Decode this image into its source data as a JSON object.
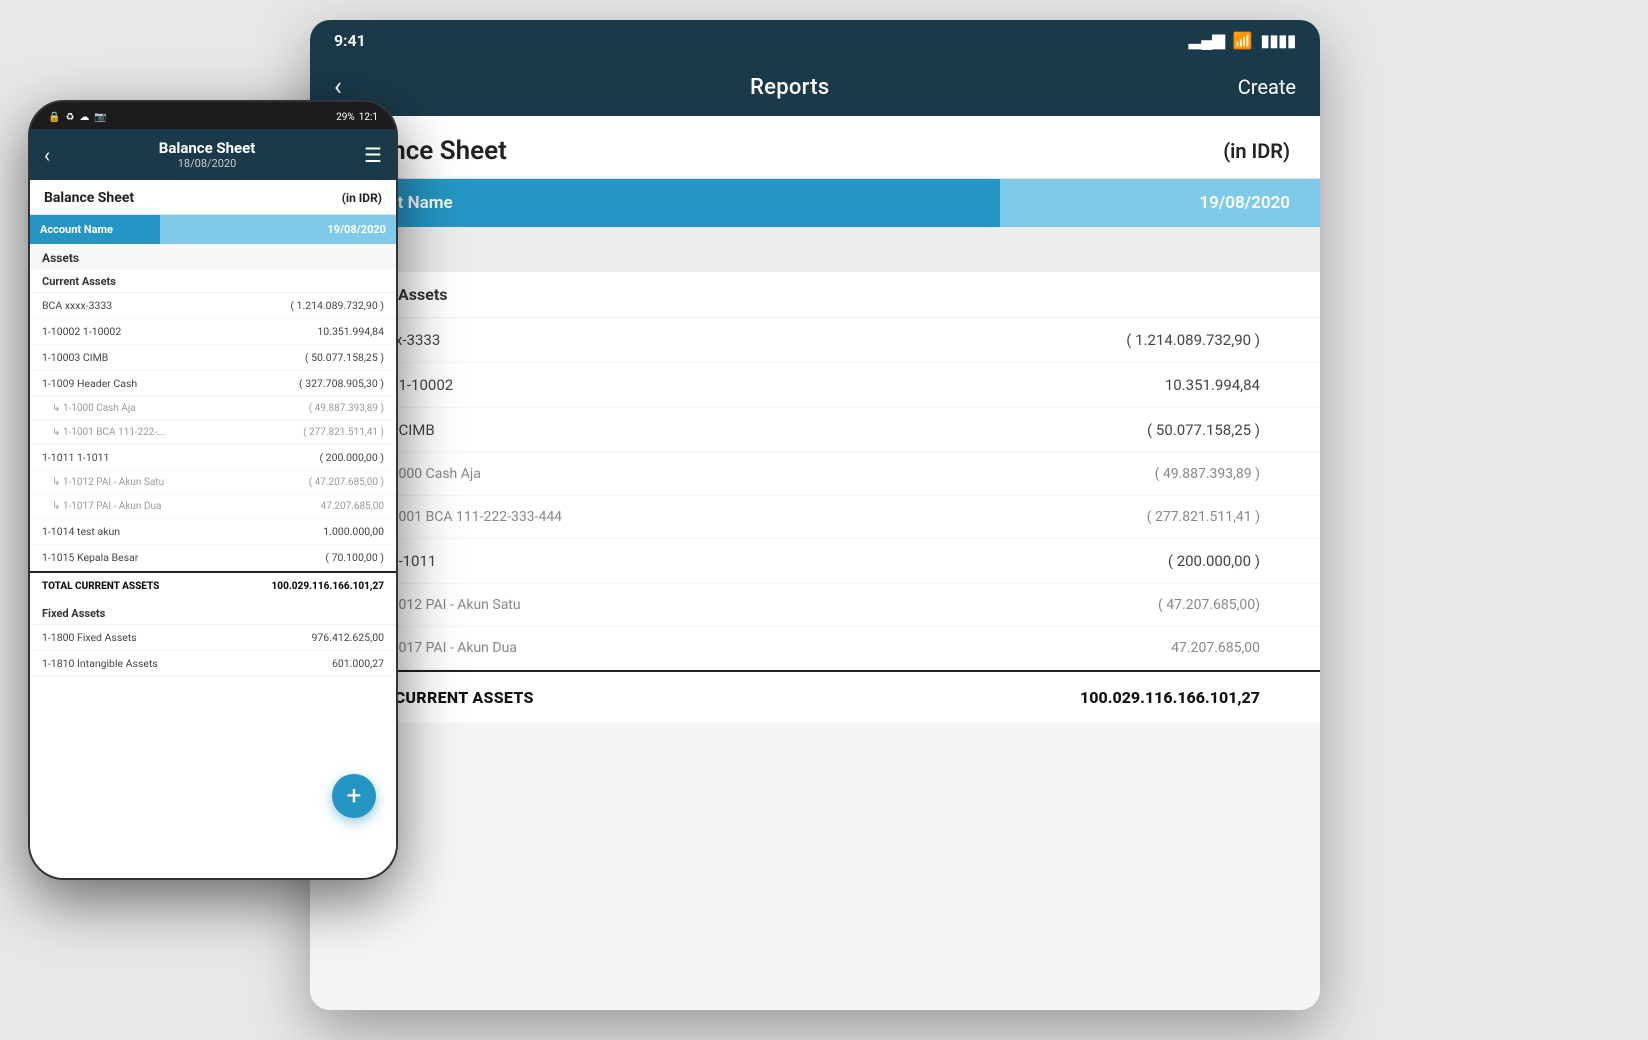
{
  "tablet": {
    "status_bar": {
      "time": "9:41",
      "signal": "▂▄▆█",
      "wifi": "WiFi",
      "battery": "Battery"
    },
    "nav": {
      "back_icon": "‹",
      "title": "Reports",
      "create": "Create"
    },
    "sheet": {
      "title": "Balance Sheet",
      "currency": "(in IDR)"
    },
    "col_header": {
      "name": "Account Name",
      "date": "19/08/2020"
    },
    "sections": {
      "assets_label": "Assets",
      "current_assets_label": "Current Assets",
      "rows": [
        {
          "name": "BCA xxxx-3333",
          "value": "( 1.214.089.732,90 )",
          "indented": false
        },
        {
          "name": "1-10002 1-10002",
          "value": "10.351.994,84",
          "indented": false
        },
        {
          "name": "1-10003 CIMB",
          "value": "( 50.077.158,25 )",
          "indented": false
        },
        {
          "name": "1-1000 Cash Aja",
          "value": "( 49.887.393,89 )",
          "indented": true
        },
        {
          "name": "1-1001 BCA 111-222-333-444",
          "value": "( 277.821.511,41 )",
          "indented": true
        },
        {
          "name": "1-1011 1-1011",
          "value": "( 200.000,00 )",
          "indented": false
        },
        {
          "name": "1-1012 PAI - Akun Satu",
          "value": "( 47.207.685,00)",
          "indented": true
        },
        {
          "name": "1-1017 PAI - Akun Dua",
          "value": "47.207.685,00",
          "indented": true
        }
      ],
      "total_label": "TOTAL CURRENT ASSETS",
      "total_value": "100.029.116.166.101,27"
    }
  },
  "phone": {
    "status_bar": {
      "icons_left": "🔒  ♻  ☁  📷",
      "battery": "29%",
      "time": "12:1"
    },
    "nav": {
      "back_icon": "‹",
      "title": "Balance Sheet",
      "subtitle": "18/08/2020",
      "filter_icon": "☰"
    },
    "sheet": {
      "title": "Balance Sheet",
      "currency": "(in IDR)"
    },
    "col_header": {
      "name": "Account Name",
      "date": "19/08/2020"
    },
    "sections": {
      "assets_label": "Assets",
      "current_assets_label": "Current Assets",
      "rows": [
        {
          "name": "BCA xxxx-3333",
          "value": "( 1.214.089.732,90 )",
          "indented": false
        },
        {
          "name": "1-10002 1-10002",
          "value": "10.351.994,84",
          "indented": false
        },
        {
          "name": "1-10003 CIMB",
          "value": "( 50.077.158,25 )",
          "indented": false
        },
        {
          "name": "1-1009 Header Cash",
          "value": "( 327.708.905,30 )",
          "indented": false
        },
        {
          "name": "↳ 1-1000 Cash Aja",
          "value": "( 49.887.393,89 )",
          "indented": true
        },
        {
          "name": "↳ 1-1001 BCA 111-222-...",
          "value": "( 277.821.511,41 )",
          "indented": true
        },
        {
          "name": "1-1011 1-1011",
          "value": "( 200.000,00 )",
          "indented": false
        },
        {
          "name": "↳ 1-1012 PAI - Akun Satu",
          "value": "( 47.207.685,00 )",
          "indented": true
        },
        {
          "name": "↳ 1-1017 PAI - Akun Dua",
          "value": "47.207.685,00",
          "indented": true
        },
        {
          "name": "1-1014 test akun",
          "value": "1.000.000,00",
          "indented": false
        },
        {
          "name": "1-1015 Kepala Besar",
          "value": "( 70.100,00 )",
          "indented": false
        }
      ],
      "total_label": "TOTAL CURRENT ASSETS",
      "total_value": "100.029.116.166.101,27",
      "fixed_assets_label": "Fixed Assets",
      "fixed_rows": [
        {
          "name": "1-1800 Fixed Assets",
          "value": "976.412.625,00"
        },
        {
          "name": "1-1810 Intangible Assets",
          "value": "601.000,27"
        }
      ]
    }
  }
}
